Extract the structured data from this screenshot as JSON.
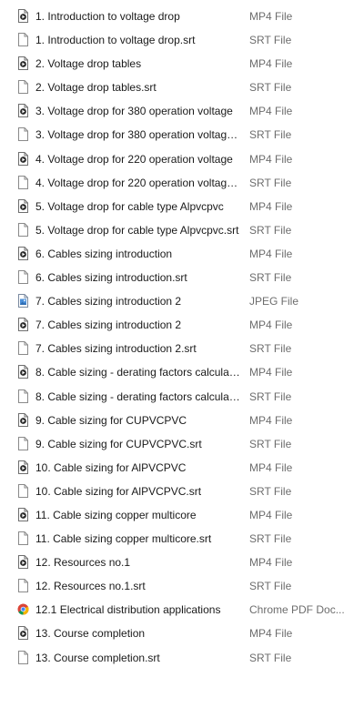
{
  "files": [
    {
      "name": "1. Introduction to voltage drop",
      "type": "MP4 File",
      "icon": "video-file-icon"
    },
    {
      "name": "1. Introduction to voltage drop.srt",
      "type": "SRT File",
      "icon": "document-file-icon"
    },
    {
      "name": "2. Voltage drop tables",
      "type": "MP4 File",
      "icon": "video-file-icon"
    },
    {
      "name": "2. Voltage drop tables.srt",
      "type": "SRT File",
      "icon": "document-file-icon"
    },
    {
      "name": "3. Voltage drop for 380 operation voltage",
      "type": "MP4 File",
      "icon": "video-file-icon"
    },
    {
      "name": "3. Voltage drop for 380 operation voltage....",
      "type": "SRT File",
      "icon": "document-file-icon"
    },
    {
      "name": "4. Voltage drop for 220 operation voltage",
      "type": "MP4 File",
      "icon": "video-file-icon"
    },
    {
      "name": "4. Voltage drop for 220 operation voltage....",
      "type": "SRT File",
      "icon": "document-file-icon"
    },
    {
      "name": "5. Voltage drop for cable type Alpvcpvc",
      "type": "MP4 File",
      "icon": "video-file-icon"
    },
    {
      "name": "5. Voltage drop for cable type Alpvcpvc.srt",
      "type": "SRT File",
      "icon": "document-file-icon"
    },
    {
      "name": "6. Cables sizing introduction",
      "type": "MP4 File",
      "icon": "video-file-icon"
    },
    {
      "name": "6. Cables sizing introduction.srt",
      "type": "SRT File",
      "icon": "document-file-icon"
    },
    {
      "name": "7. Cables sizing introduction 2",
      "type": "JPEG File",
      "icon": "image-file-icon"
    },
    {
      "name": "7. Cables sizing introduction 2",
      "type": "MP4 File",
      "icon": "video-file-icon"
    },
    {
      "name": "7. Cables sizing introduction 2.srt",
      "type": "SRT File",
      "icon": "document-file-icon"
    },
    {
      "name": "8. Cable sizing - derating factors calculati...",
      "type": "MP4 File",
      "icon": "video-file-icon"
    },
    {
      "name": "8. Cable sizing - derating factors calculati...",
      "type": "SRT File",
      "icon": "document-file-icon"
    },
    {
      "name": "9. Cable sizing for CUPVCPVC",
      "type": "MP4 File",
      "icon": "video-file-icon"
    },
    {
      "name": "9. Cable sizing for CUPVCPVC.srt",
      "type": "SRT File",
      "icon": "document-file-icon"
    },
    {
      "name": "10. Cable sizing for AlPVCPVC",
      "type": "MP4 File",
      "icon": "video-file-icon"
    },
    {
      "name": "10. Cable sizing for AlPVCPVC.srt",
      "type": "SRT File",
      "icon": "document-file-icon"
    },
    {
      "name": "11. Cable sizing copper multicore",
      "type": "MP4 File",
      "icon": "video-file-icon"
    },
    {
      "name": "11. Cable sizing copper multicore.srt",
      "type": "SRT File",
      "icon": "document-file-icon"
    },
    {
      "name": "12. Resources no.1",
      "type": "MP4 File",
      "icon": "video-file-icon"
    },
    {
      "name": "12. Resources no.1.srt",
      "type": "SRT File",
      "icon": "document-file-icon"
    },
    {
      "name": "12.1 Electrical distribution applications",
      "type": "Chrome PDF Doc...",
      "icon": "chrome-pdf-file-icon"
    },
    {
      "name": "13. Course completion",
      "type": "MP4 File",
      "icon": "video-file-icon"
    },
    {
      "name": "13. Course completion.srt",
      "type": "SRT File",
      "icon": "document-file-icon"
    }
  ]
}
